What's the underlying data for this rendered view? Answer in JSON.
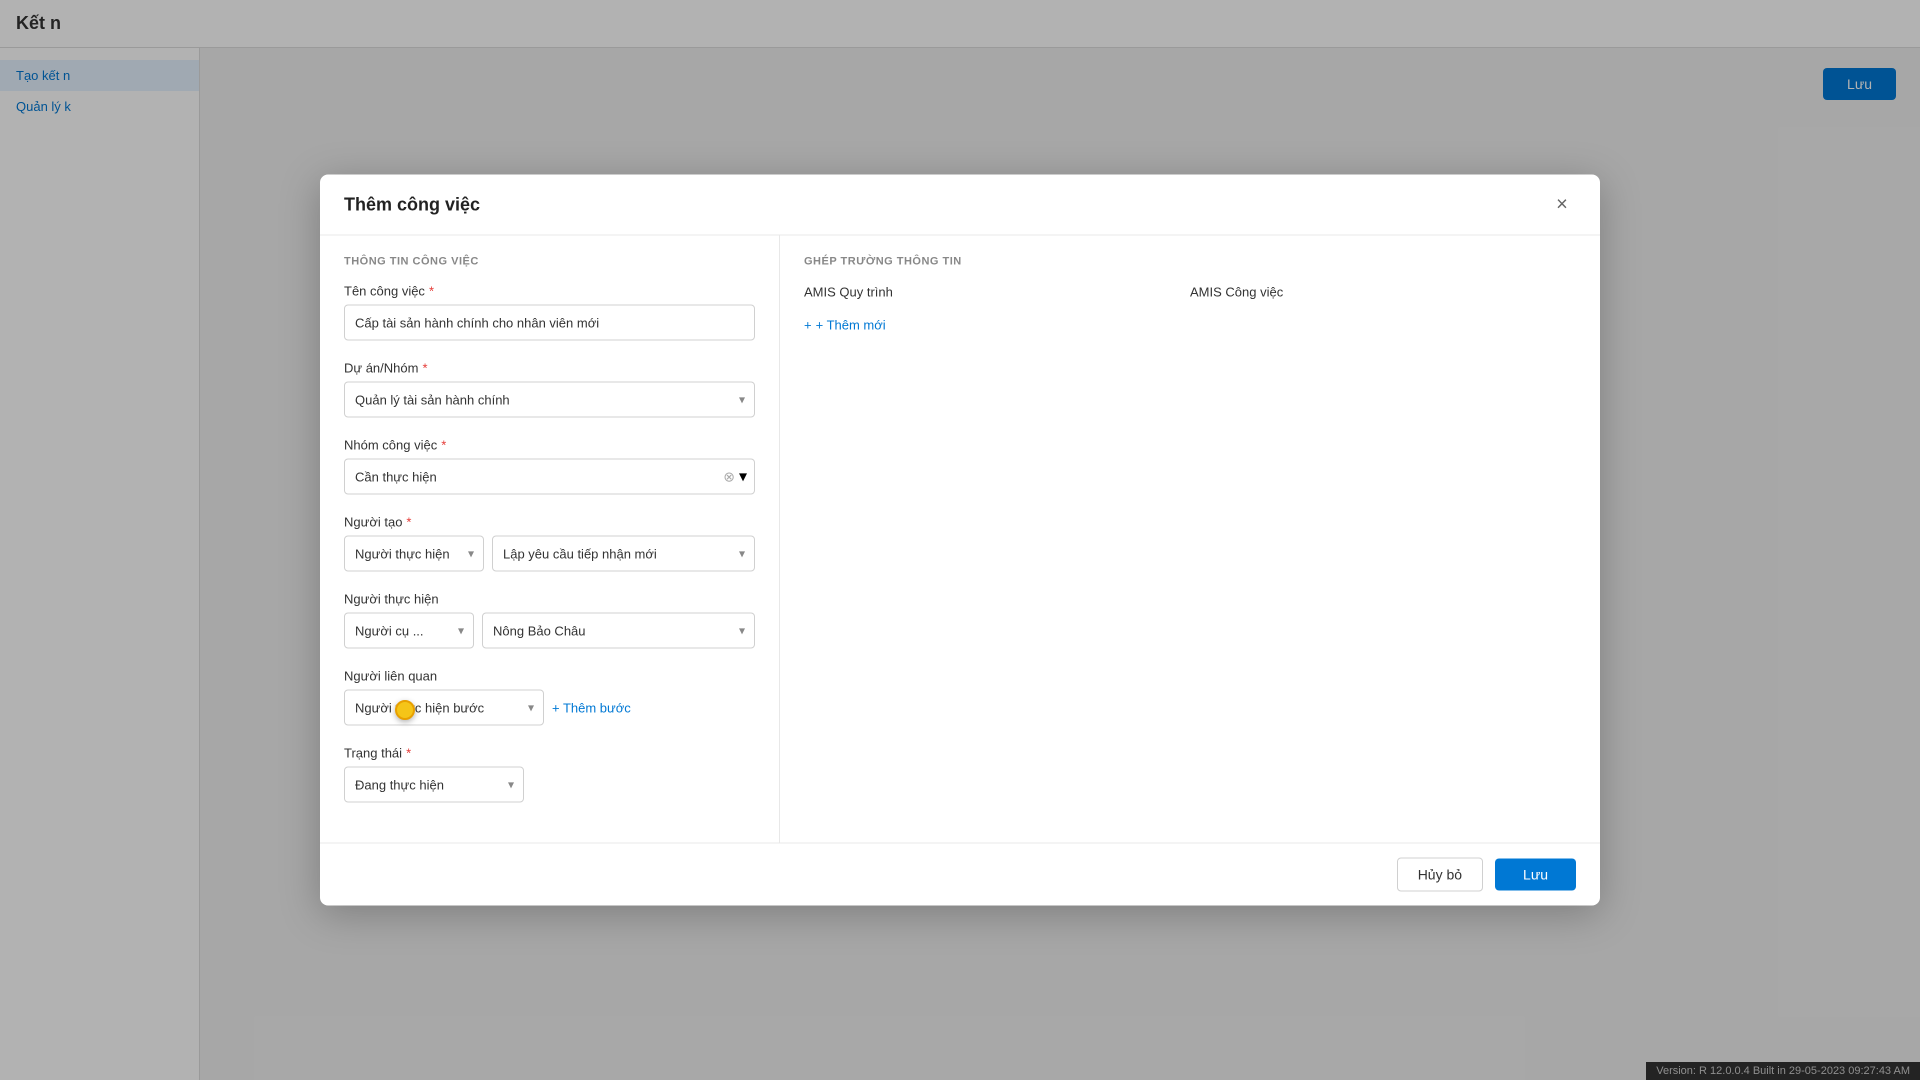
{
  "app": {
    "title": "Kết n",
    "version_bar": "Version: R 12.0.0.4 Built in 29-05-2023 09:27:43 AM"
  },
  "sidebar": {
    "items": [
      {
        "id": "tao-ket-noi",
        "label": "Tạo kết n",
        "active": true
      },
      {
        "id": "quan-ly",
        "label": "Quản lý k",
        "active": false
      }
    ]
  },
  "modal": {
    "title": "Thêm công việc",
    "close_label": "×",
    "sections": {
      "left_title": "THÔNG TIN CÔNG VIỆC",
      "right_title": "GHÉP TRƯỜNG THÔNG TIN"
    },
    "fields": {
      "ten_cong_viec": {
        "label": "Tên công việc",
        "required": true,
        "value": "Cấp tài sản hành chính cho nhân viên mới"
      },
      "du_an_nhom": {
        "label": "Dự án/Nhóm",
        "required": true,
        "value": "Quản lý tài sản hành chính",
        "options": [
          "Quản lý tài sản hành chính"
        ]
      },
      "nhom_cong_viec": {
        "label": "Nhóm công việc",
        "required": true,
        "value": "Cần thực hiện",
        "options": [
          "Cần thực hiện"
        ]
      },
      "nguoi_tao": {
        "label": "Người tạo",
        "required": true,
        "col1_value": "Người thực hiện bước",
        "col1_options": [
          "Người thực hiện bước"
        ],
        "col2_value": "Lập yêu cầu tiếp nhận mới",
        "col2_options": [
          "Lập yêu cầu tiếp nhận mới"
        ]
      },
      "nguoi_thuc_hien": {
        "label": "Người thực hiện",
        "required": false,
        "col1_value": "Người cụ ...",
        "col1_options": [
          "Người cụ ..."
        ],
        "col2_value": "Nông Bảo Châu",
        "col2_options": [
          "Nông Bảo Châu"
        ]
      },
      "nguoi_lien_quan": {
        "label": "Người liên quan",
        "required": false,
        "col1_value": "Người thực hiện bước",
        "col1_options": [
          "Người thực hiện bước"
        ],
        "them_buoc_label": "+ Thêm bước"
      },
      "trang_thai": {
        "label": "Trạng thái",
        "required": true,
        "value": "Đang thực hiện",
        "options": [
          "Đang thực hiện"
        ]
      }
    },
    "ghep_truong": {
      "amis_quy_trinh_col": "AMIS Quy trình",
      "amis_cong_viec_col": "AMIS Công việc",
      "them_moi_label": "+ Thêm mới"
    },
    "footer": {
      "cancel_label": "Hủy bỏ",
      "save_label": "Lưu"
    },
    "header_save_label": "Lưu"
  },
  "icons": {
    "close": "×",
    "chevron_down": "▾",
    "clear": "⊗",
    "plus": "+"
  }
}
